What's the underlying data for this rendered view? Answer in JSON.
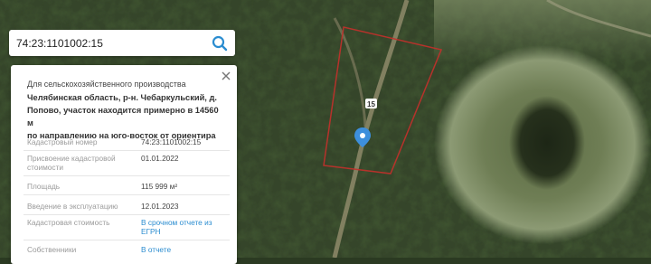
{
  "search": {
    "value": "74:23:1101002:15",
    "icon": "search-icon"
  },
  "map": {
    "parcel_outline_color": "#c4302b",
    "marker_color": "#3d8fdc",
    "road_number": "15"
  },
  "panel": {
    "purpose": "Для сельскохозяйственного производства",
    "address_lines": [
      "Челябинская область, р-н. Чебаркульский, д.",
      "Попово, участок находится примерно в 14560 м",
      "по направлению на юго-восток от ориентира"
    ],
    "rows": [
      {
        "label": "Кадастровый номер",
        "value": "74:23:1101002:15"
      },
      {
        "label": "Присвоение кадастровой стоимости",
        "value": "01.01.2022"
      },
      {
        "label": "Площадь",
        "value": "115 999 м²"
      },
      {
        "label": "Введение в эксплуатацию",
        "value": "12.01.2023"
      },
      {
        "label": "Кадастровая стоимость",
        "value": "В срочном отчете из ЕГРН"
      },
      {
        "label": "Собственники",
        "value": "В отчете"
      }
    ]
  }
}
